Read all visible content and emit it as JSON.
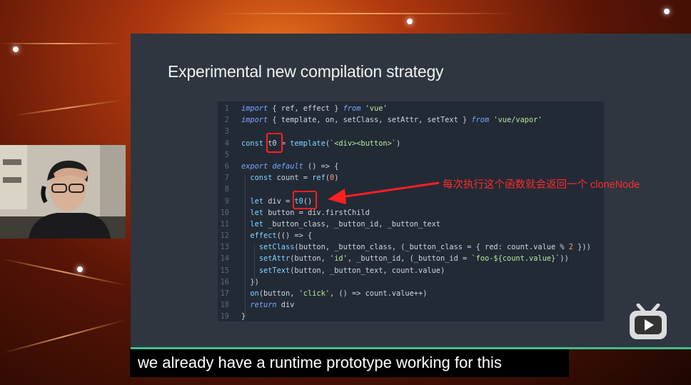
{
  "slide": {
    "title": "Experimental new compilation strategy",
    "code_lines": [
      {
        "n": "1",
        "html": "<span class=\"kw\">import</span> { ref, effect } <span class=\"kw\">from</span> <span class=\"str\">'vue'</span>"
      },
      {
        "n": "2",
        "html": "<span class=\"kw\">import</span> { template, on, setClass, setAttr, setText } <span class=\"kw\">from</span> <span class=\"str\">'vue/vapor'</span>"
      },
      {
        "n": "3",
        "html": ""
      },
      {
        "n": "4",
        "html": "<span class=\"fn\">const</span> t0 = <span class=\"fn\">template</span>(<span class=\"str\">`&lt;div&gt;&lt;button&gt;`</span>)"
      },
      {
        "n": "5",
        "html": ""
      },
      {
        "n": "6",
        "html": "<span class=\"kw\">export default</span> () => {"
      },
      {
        "n": "7",
        "html": "  <span class=\"fn\">const</span> count = <span class=\"fn\">ref</span>(<span class=\"nm\">0</span>)"
      },
      {
        "n": "8",
        "html": ""
      },
      {
        "n": "9",
        "html": "  <span class=\"fn\">let</span> div = <span class=\"fn\">t0</span>()"
      },
      {
        "n": "10",
        "html": "  <span class=\"fn\">let</span> button = div.firstChild"
      },
      {
        "n": "11",
        "html": "  <span class=\"fn\">let</span> _button_class, _button_id, _button_text"
      },
      {
        "n": "12",
        "html": "  <span class=\"fn\">effect</span>(() => {"
      },
      {
        "n": "13",
        "html": "    <span class=\"fn\">setClass</span>(button, _button_class, (_button_class = { red: count.value % <span class=\"nm\">2</span> }))"
      },
      {
        "n": "14",
        "html": "    <span class=\"fn\">setAttr</span>(button, <span class=\"str\">'id'</span>, _button_id, (_button_id = <span class=\"str\">`foo-${count.value}`</span>))"
      },
      {
        "n": "15",
        "html": "    <span class=\"fn\">setText</span>(button, _button_text, count.value)"
      },
      {
        "n": "16",
        "html": "  })"
      },
      {
        "n": "17",
        "html": "  <span class=\"fn\">on</span>(button, <span class=\"str\">'click'</span>, () => count.value++)"
      },
      {
        "n": "18",
        "html": "  <span class=\"kw\">return</span> div"
      },
      {
        "n": "19",
        "html": "}"
      }
    ]
  },
  "annotation": {
    "text": "每次执行这个函数就会返回一个 cloneNode",
    "color": "#ff2b2b"
  },
  "subtitle": "we already have a runtime prototype working for this",
  "colors": {
    "slide_bg": "#2f3640",
    "code_bg": "#222a36",
    "accent_line": "#3fbf8e"
  },
  "icons": {
    "watermark": "bilibili-tv-icon"
  }
}
